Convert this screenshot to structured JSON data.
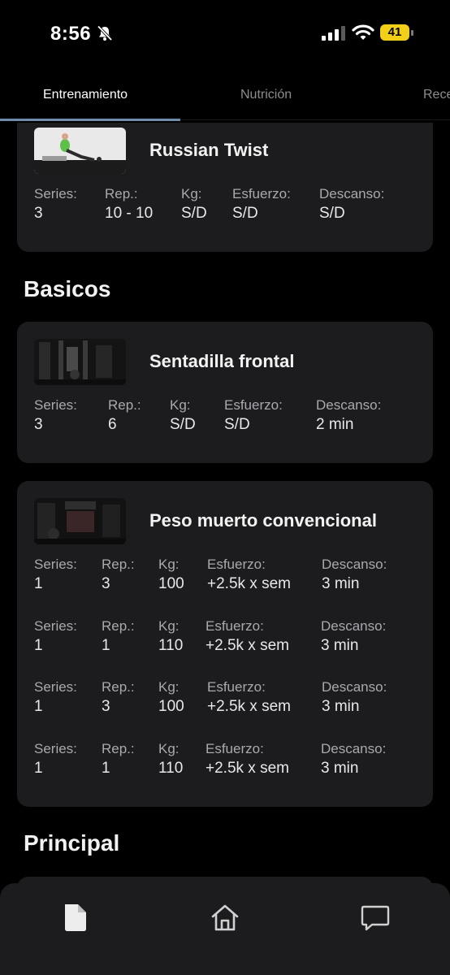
{
  "status_bar": {
    "time": "8:56",
    "battery": "41"
  },
  "tabs": [
    {
      "label": "Entrenamiento",
      "active": true
    },
    {
      "label": "Nutrición",
      "active": false
    },
    {
      "label": "Rece",
      "active": false
    }
  ],
  "field_labels": {
    "series": "Series:",
    "reps": "Rep.:",
    "kg": "Kg:",
    "effort": "Esfuerzo:",
    "rest": "Descanso:"
  },
  "exercises": [
    {
      "title": "Russian Twist",
      "sets": [
        {
          "series": "3",
          "reps": "10 - 10",
          "kg": "S/D",
          "effort": "S/D",
          "rest": "S/D"
        }
      ]
    },
    {
      "title": "Sentadilla frontal",
      "sets": [
        {
          "series": "3",
          "reps": "6",
          "kg": "S/D",
          "effort": "S/D",
          "rest": "2 min"
        }
      ]
    },
    {
      "title": "Peso muerto convencional",
      "sets": [
        {
          "series": "1",
          "reps": "3",
          "kg": "100",
          "effort": "+2.5k x sem",
          "rest": "3 min"
        },
        {
          "series": "1",
          "reps": "1",
          "kg": "110",
          "effort": "+2.5k x sem",
          "rest": "3 min"
        },
        {
          "series": "1",
          "reps": "3",
          "kg": "100",
          "effort": "+2.5k x sem",
          "rest": "3 min"
        },
        {
          "series": "1",
          "reps": "1",
          "kg": "110",
          "effort": "+2.5k x sem",
          "rest": "3 min"
        }
      ]
    }
  ],
  "sections": {
    "basicos": "Basicos",
    "principal": "Principal"
  },
  "bottom_nav": [
    {
      "icon": "document-icon",
      "active": true
    },
    {
      "icon": "home-icon",
      "active": false
    },
    {
      "icon": "chat-icon",
      "active": false
    }
  ]
}
